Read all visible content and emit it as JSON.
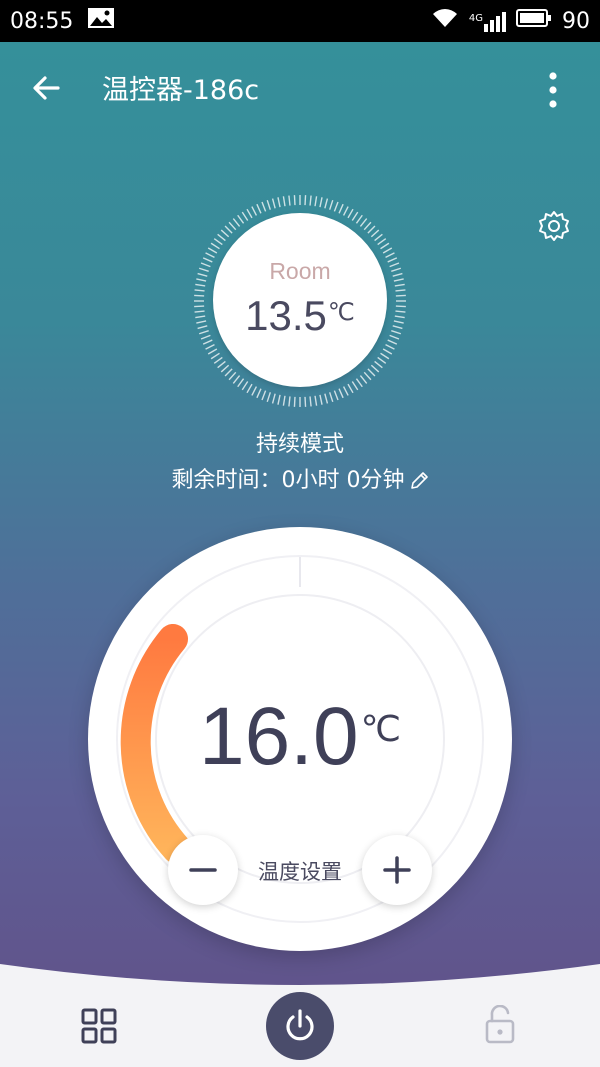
{
  "statusbar": {
    "time": "08:55",
    "network": "4G",
    "battery": "90",
    "icons": [
      "image-icon",
      "wifi-icon",
      "signal-icon",
      "battery-icon"
    ]
  },
  "appbar": {
    "title": "温控器-186c",
    "icons": [
      "back-arrow-icon",
      "more-vert-icon"
    ]
  },
  "settings_icon": "gear-icon",
  "room": {
    "label": "Room",
    "temp": "13.5",
    "unit": "℃"
  },
  "mode": {
    "text": "持续模式",
    "remaining": "剩余时间：0小时 0分钟",
    "edit_icon": "pencil-icon"
  },
  "setpoint": {
    "temp": "16.0",
    "unit": "℃",
    "label": "温度设置",
    "arc_color_start": "#f5a04a",
    "arc_color_end": "#ff7f45"
  },
  "bottom_nav": {
    "items": [
      "grid-icon",
      "power-icon",
      "lock-open-icon"
    ],
    "power_bg": "#4a4c6b"
  },
  "colors": {
    "bg_top": "#34919a",
    "bg_bottom": "#614f86",
    "bottom_bar": "#f3f3f6"
  }
}
